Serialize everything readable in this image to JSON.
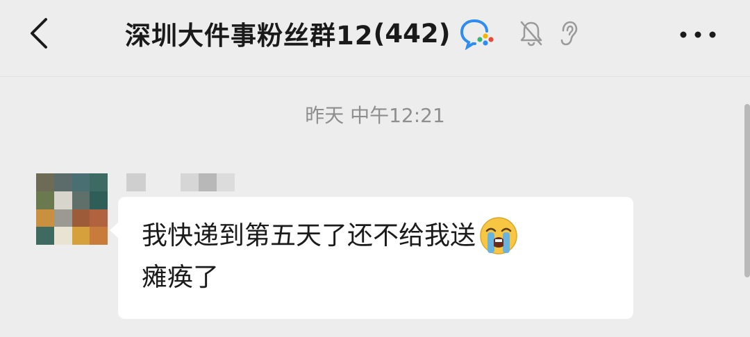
{
  "header": {
    "title": "深圳大件事粉丝群12",
    "member_count": "(442)"
  },
  "chat": {
    "timestamp": "昨天 中午12:21",
    "message": {
      "line1": "我快递到第五天了还不给我送",
      "line2": "瘫痪了",
      "emoji": "loudly-crying-face-emoji"
    }
  },
  "icons": {
    "back": "back-arrow-icon",
    "wecom": "wecom-icon",
    "mute": "mute-bell-icon",
    "earpiece": "ear-icon",
    "more": "more-icon"
  }
}
